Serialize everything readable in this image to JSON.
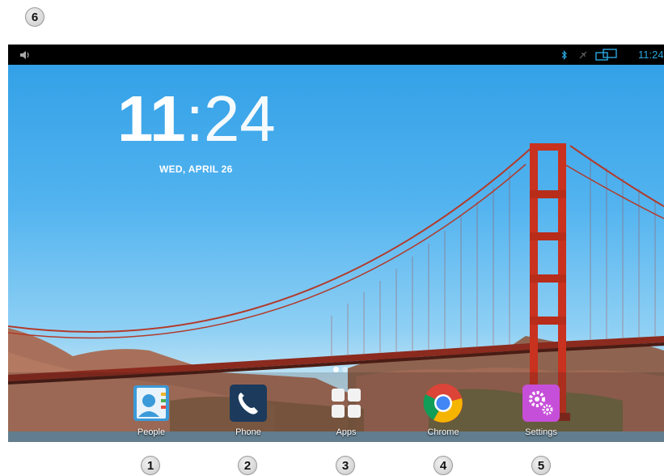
{
  "callouts": {
    "c1": "1",
    "c2": "2",
    "c3": "3",
    "c4": "4",
    "c5": "5",
    "c6": "6"
  },
  "status": {
    "time": "11:24"
  },
  "lockclock": {
    "hour": "11",
    "colon": ":",
    "minute": "24",
    "date": "WED, APRIL 26"
  },
  "pager": {
    "page_count": 2,
    "active_page": 1
  },
  "dock": {
    "apps": [
      {
        "label": "People",
        "icon": "contacts-icon"
      },
      {
        "label": "Phone",
        "icon": "phone-icon"
      },
      {
        "label": "Apps",
        "icon": "app-drawer-icon"
      },
      {
        "label": "Chrome",
        "icon": "chrome-icon"
      },
      {
        "label": "Settings",
        "icon": "settings-gear-icon"
      }
    ]
  },
  "colors": {
    "status_accent": "#2aa8e0",
    "bridge_red": "#c8321f",
    "sky": "#3aa6ea"
  }
}
